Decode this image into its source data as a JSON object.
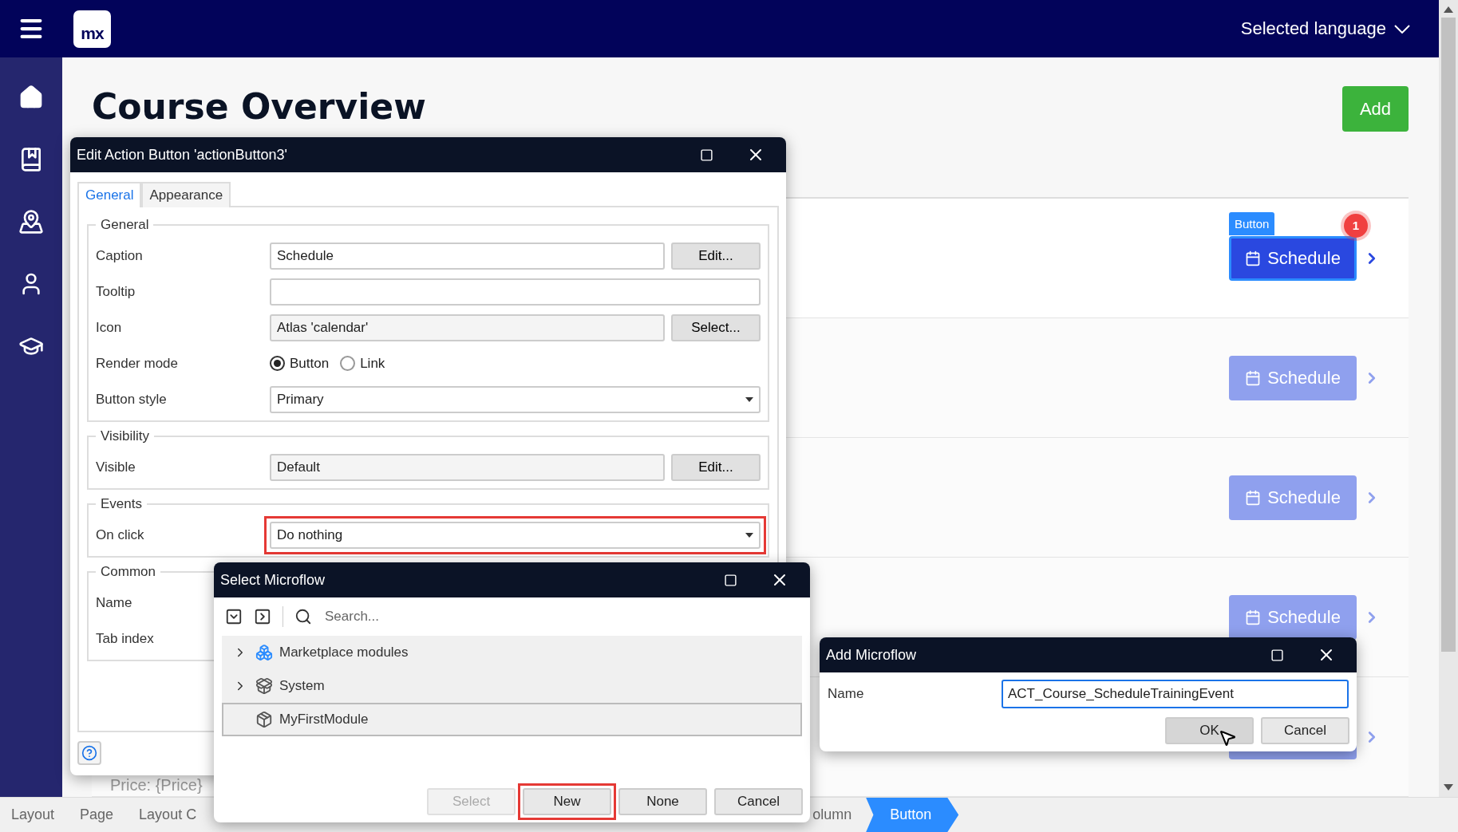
{
  "topbar": {
    "logo": "mx",
    "language": "Selected language"
  },
  "page": {
    "title": "Course Overview",
    "add_button": "Add",
    "selection_tag": "Button",
    "badge": "1",
    "price_text": "Price: {Price}",
    "rows": [
      {
        "button": "Schedule",
        "selected": true
      },
      {
        "button": "Schedule",
        "selected": false
      },
      {
        "button": "Schedule",
        "selected": false
      },
      {
        "button": "Schedule",
        "selected": false
      },
      {
        "selected": false
      }
    ]
  },
  "breadcrumb": [
    {
      "label": "Layout",
      "selected": false
    },
    {
      "label": "Page",
      "selected": false
    },
    {
      "label": "Layout C",
      "selected": false
    },
    {
      "label": "olumn",
      "selected": false
    },
    {
      "label": "Button",
      "selected": true
    }
  ],
  "edit_dialog": {
    "title": "Edit Action Button 'actionButton3'",
    "tabs": [
      {
        "label": "General",
        "selected": true
      },
      {
        "label": "Appearance",
        "selected": false
      }
    ],
    "groups": [
      {
        "legend": "General",
        "rows": [
          {
            "kind": "text",
            "label": "Caption",
            "value": "Schedule",
            "button": "Edit..."
          },
          {
            "kind": "text",
            "label": "Tooltip"
          },
          {
            "kind": "readonly",
            "label": "Icon",
            "value": "Atlas 'calendar'",
            "button": "Select..."
          },
          {
            "kind": "radio",
            "label": "Render mode",
            "options": [
              {
                "label": "Button",
                "selected": true
              },
              {
                "label": "Link",
                "selected": false
              }
            ]
          },
          {
            "kind": "dropdown",
            "label": "Button style",
            "value": "Primary",
            "highlighted": false
          }
        ]
      },
      {
        "legend": "Visibility",
        "rows": [
          {
            "kind": "readonly",
            "label": "Visible",
            "value": "Default",
            "button": "Edit..."
          }
        ]
      },
      {
        "legend": "Events",
        "rows": [
          {
            "kind": "dropdown",
            "label": "On click",
            "value": "Do nothing",
            "highlighted": true
          }
        ]
      },
      {
        "legend": "Common",
        "rows": [
          {
            "kind": "label",
            "label": "Name"
          },
          {
            "kind": "label",
            "label": "Tab index"
          }
        ]
      }
    ]
  },
  "select_dialog": {
    "title": "Select Microflow",
    "search_placeholder": "Search...",
    "tree": [
      {
        "label": "Marketplace modules",
        "kind": "marketplace",
        "expandable": true,
        "selected": false
      },
      {
        "label": "System",
        "kind": "system",
        "expandable": true,
        "selected": false
      },
      {
        "label": "MyFirstModule",
        "kind": "module",
        "expandable": false,
        "selected": true
      }
    ],
    "buttons": [
      {
        "label": "Select",
        "disabled": true,
        "highlighted": false
      },
      {
        "label": "New",
        "disabled": false,
        "highlighted": true
      },
      {
        "label": "None",
        "disabled": false,
        "highlighted": false
      },
      {
        "label": "Cancel",
        "disabled": false,
        "highlighted": false
      }
    ]
  },
  "add_dialog": {
    "title": "Add Microflow",
    "label": "Name",
    "value": "ACT_Course_ScheduleTrainingEvent",
    "buttons": [
      {
        "label": "OK",
        "hovered": true
      },
      {
        "label": "Cancel",
        "hovered": false
      }
    ]
  }
}
